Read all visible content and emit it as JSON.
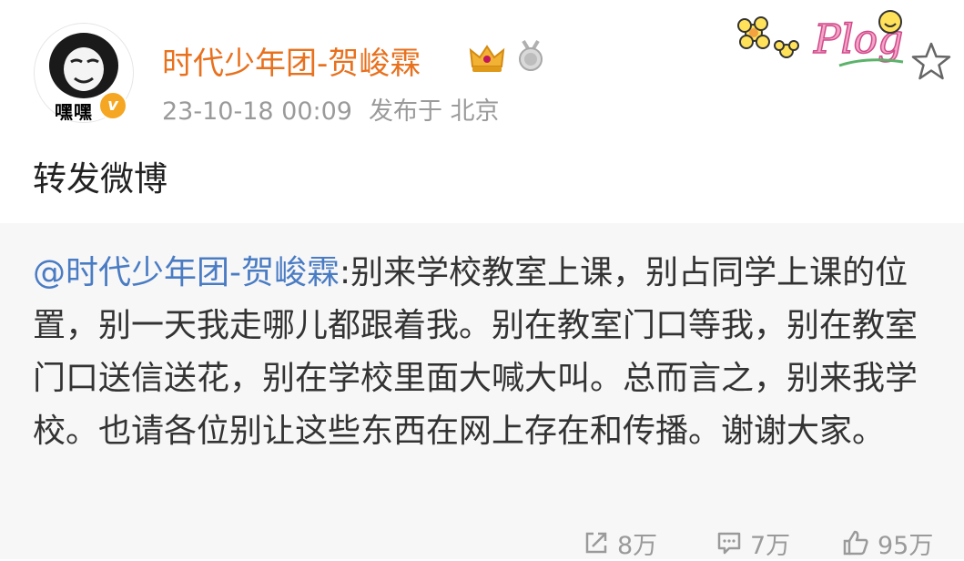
{
  "header": {
    "avatar_text": "嘿嘿",
    "verified_mark": "v",
    "username": "时代少年团-贺峻霖",
    "timestamp": "23-10-18 00:09",
    "location": "发布于 北京",
    "decoration_text": "Plog"
  },
  "post": {
    "text": "转发微博"
  },
  "repost": {
    "mention": "@时代少年团-贺峻霖",
    "text": ":别来学校教室上课，别占同学上课的位置，别一天我走哪儿都跟着我。别在教室门口等我，别在教室门口送信送花，别在学校里面大喊大叫。总而言之，别来我学校。也请各位别让这些东西在网上存在和传播。谢谢大家。"
  },
  "actions": {
    "reposts": "8万",
    "comments": "7万",
    "likes": "95万"
  },
  "icons": {
    "favorite": "star-icon",
    "repost": "share-icon",
    "comment": "comment-icon",
    "like": "thumbs-up-icon"
  },
  "colors": {
    "username": "#e8711e",
    "mention": "#4a7cc4",
    "meta": "#9a9a9a",
    "repost_bg": "#f7f7f7"
  }
}
